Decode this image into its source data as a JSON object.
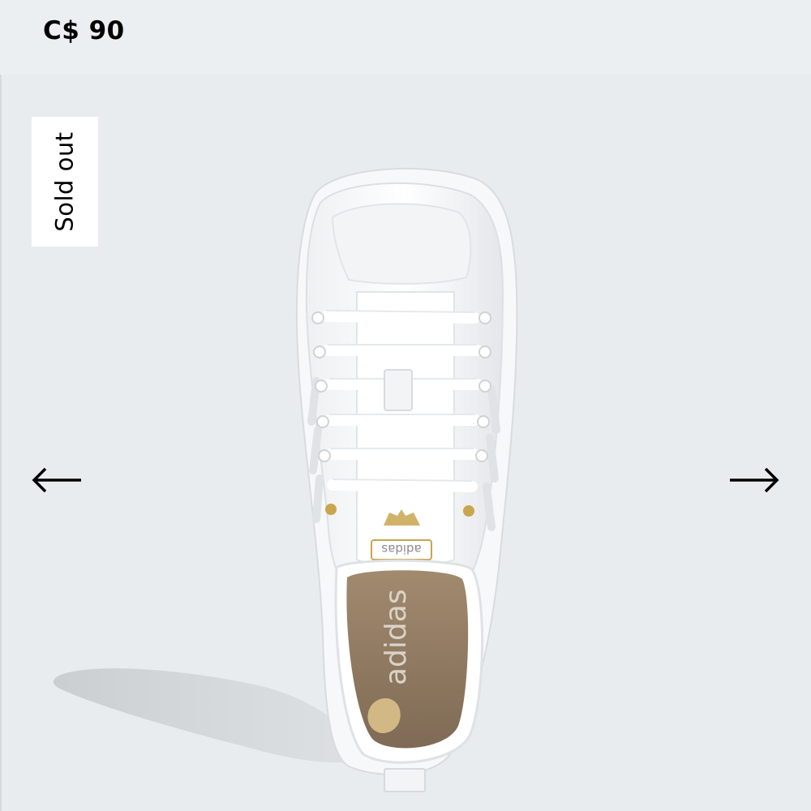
{
  "product": {
    "price": "C$ 90",
    "badge": "Sold out",
    "image_brand_text": "adidas"
  },
  "gallery": {
    "prev_icon": "arrow-left-icon",
    "next_icon": "arrow-right-icon"
  },
  "colors": {
    "page_background": "#e9ecee",
    "badge_background": "#ffffff",
    "text": "#000000",
    "insole": "#8f7a63"
  }
}
